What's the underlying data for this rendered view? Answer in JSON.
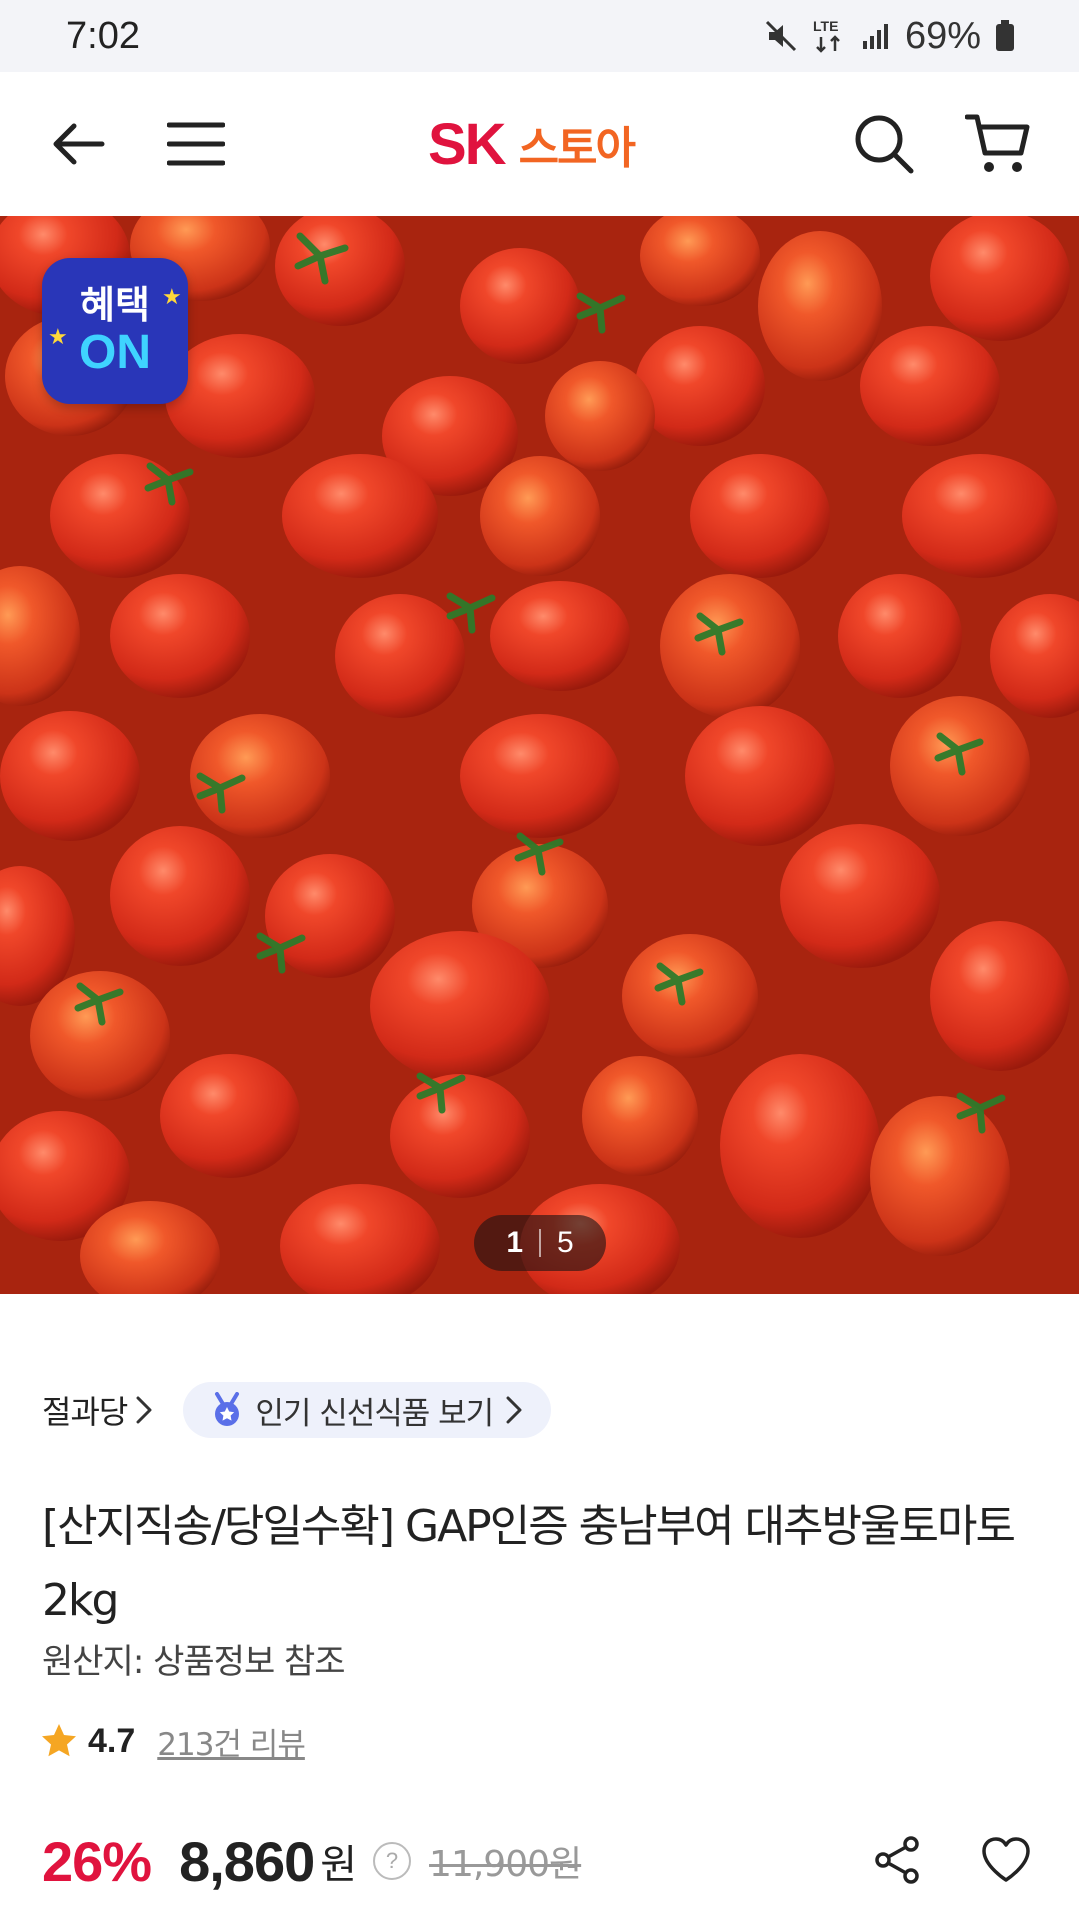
{
  "status_bar": {
    "time": "7:02",
    "network": "LTE",
    "battery": "69%",
    "icons": [
      "mute-icon",
      "lte-icon",
      "signal-icon",
      "battery-icon"
    ]
  },
  "header": {
    "logo_sk": "SK",
    "logo_store": "스토아",
    "icons": [
      "back-arrow-icon",
      "menu-icon",
      "search-icon",
      "cart-icon"
    ]
  },
  "hero": {
    "badge_top": "혜택",
    "badge_bottom": "ON",
    "pager_current": "1",
    "pager_total": "5"
  },
  "category": {
    "store_link": "절과당",
    "popular_label": "인기 신선식품 보기"
  },
  "product": {
    "title": "[산지직송/당일수확] GAP인증 충남부여 대추방울토마토 2kg",
    "origin": "원산지: 상품정보 참조",
    "rating": "4.7",
    "review_count": "213건 리뷰",
    "discount": "26%",
    "price": "8,860",
    "price_unit": "원",
    "original_price": "11,900원"
  },
  "colors": {
    "brand_red": "#e0133e",
    "brand_orange": "#f26522",
    "badge_blue": "#2936b8",
    "star": "#f5a623"
  }
}
